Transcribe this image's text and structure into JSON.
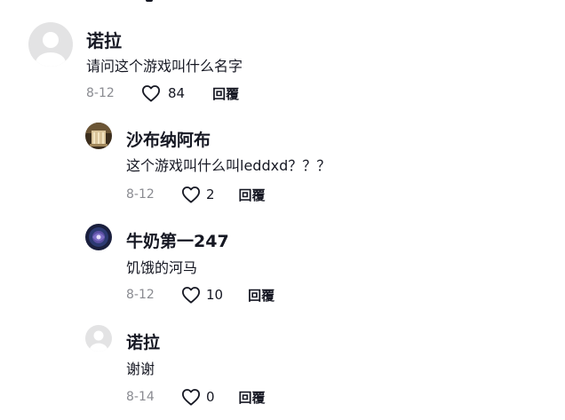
{
  "comments": [
    {
      "author": "诺拉",
      "text": "请问这个游戏叫什么名字",
      "date": "8-12",
      "likes": "84",
      "reply_label": "回覆",
      "avatar_icon": "default-avatar-icon"
    },
    {
      "author": "沙布纳阿布",
      "text": "这个游戏叫什么叫leddxd？？？",
      "date": "8-12",
      "likes": "2",
      "reply_label": "回覆",
      "avatar_icon": "building-photo-avatar"
    },
    {
      "author": "牛奶第一247",
      "text": "饥饿的河马",
      "date": "8-12",
      "likes": "10",
      "reply_label": "回覆",
      "avatar_icon": "galaxy-photo-avatar"
    },
    {
      "author": "诺拉",
      "text": "谢谢",
      "date": "8-14",
      "likes": "0",
      "reply_label": "回覆",
      "avatar_icon": "default-avatar-icon"
    }
  ],
  "colors": {
    "text": "#161823",
    "muted": "#8a8b91",
    "avatar_placeholder": "#e3e3e4"
  }
}
